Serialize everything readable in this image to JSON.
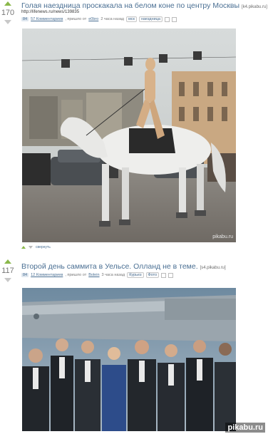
{
  "posts": [
    {
      "rating": "170",
      "title": "Голая наездница проскакала на белом коне по центру Москвы",
      "source": "[k4.pikabu.ru]",
      "link": "http://lifenews.ru/news/139835",
      "badge": "84",
      "comments": "57 Комментариев",
      "posted": ", пришло от",
      "author": "e0bro",
      "ago": "2 часа назад",
      "tags": [
        "мск",
        "наездница"
      ],
      "collapse": "свернуть",
      "watermark": "pikabu.ru"
    },
    {
      "rating": "117",
      "title": "Второй день саммита в Уельсе. Олланд не в теме.",
      "source": "[s4.pikabu.ru]",
      "badge": "84",
      "comments": "12 Комментариев",
      "posted": ", пришло от",
      "author": "Bolein",
      "ago": "3 часа назад",
      "tags": [
        "Курьез",
        "Фото"
      ]
    }
  ],
  "corner_watermark": "pikabu.ru",
  "colors": {
    "accent": "#4a6f93",
    "vote_up": "#8ab84a",
    "vote_down": "#c8c8c8"
  }
}
